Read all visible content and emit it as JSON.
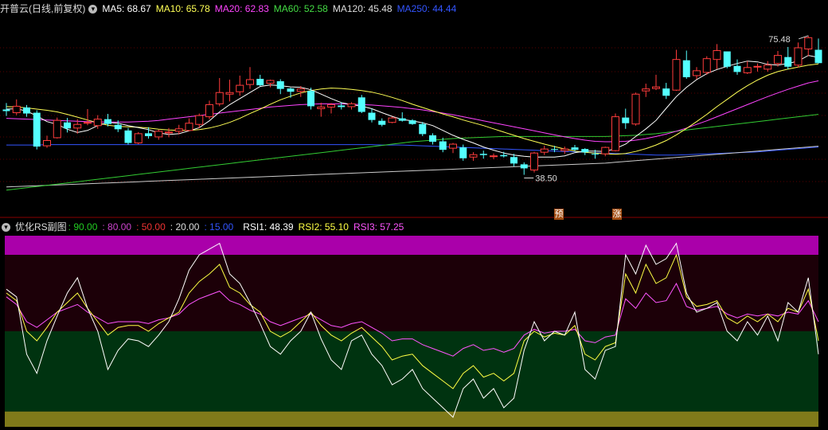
{
  "main_header": {
    "title": "开普云(日线,前复权)",
    "ma": [
      {
        "label": "MA5: 68.67",
        "color": "#ffffff"
      },
      {
        "label": "MA10: 65.78",
        "color": "#ffff55"
      },
      {
        "label": "MA20: 62.83",
        "color": "#ff44ff"
      },
      {
        "label": "MA60: 52.58",
        "color": "#44dd44"
      },
      {
        "label": "MA120: 45.48",
        "color": "#dddddd"
      },
      {
        "label": "MA250: 44.44",
        "color": "#3355ff"
      }
    ]
  },
  "annotations": {
    "high_label": "75.48",
    "low_label": "38.50",
    "tag_yu": "预",
    "tag_zhang": "涨"
  },
  "sub_header": {
    "title": "优化RS副图",
    "levels": [
      {
        "label": ": 90.00",
        "color": "#22cc22"
      },
      {
        "label": ": 80.00",
        "color": "#cc44cc"
      },
      {
        "label": ": 50.00",
        "color": "#ee3333"
      },
      {
        "label": ": 20.00",
        "color": "#dddddd"
      },
      {
        "label": ": 15.00",
        "color": "#3355ff"
      }
    ],
    "rsi": [
      {
        "label": "RSI1: 48.39",
        "color": "#ffffff"
      },
      {
        "label": "RSI2: 55.10",
        "color": "#ffff44"
      },
      {
        "label": "RSI3: 57.25",
        "color": "#ff55ff"
      }
    ]
  },
  "colors": {
    "up": "#ff3c3c",
    "down": "#54ffff",
    "ma5": "#ffffff",
    "ma10": "#ffff55",
    "ma20": "#ff44ff",
    "ma60": "#33cc33",
    "ma120": "#cccccc",
    "ma250": "#3355ff",
    "rsi1": "#ffffff",
    "rsi2": "#ffff44",
    "rsi3": "#ff55ff",
    "band_top": "#aa00aa",
    "band_upper": "#1c0008",
    "band_lower": "#003310",
    "band_bottom": "#807a1a"
  },
  "chart_data": [
    {
      "type": "candlestick",
      "title": "开普云(日线,前复权)",
      "ylim": [
        34,
        80
      ],
      "candles": [
        [
          57.2,
          58.8,
          55.6,
          56.8
        ],
        [
          56.4,
          59.7,
          55.8,
          58.0
        ],
        [
          57.7,
          58.3,
          55.4,
          56.2
        ],
        [
          56.4,
          57.0,
          47.3,
          48.0
        ],
        [
          48.2,
          50.7,
          47.7,
          49.5
        ],
        [
          50.2,
          55.2,
          50.0,
          54.5
        ],
        [
          54.0,
          55.1,
          51.5,
          52.5
        ],
        [
          52.6,
          54.8,
          51.2,
          53.5
        ],
        [
          53.8,
          57.3,
          53.3,
          54.0
        ],
        [
          53.2,
          55.8,
          52.4,
          54.8
        ],
        [
          54.8,
          56.1,
          53.0,
          53.6
        ],
        [
          53.4,
          54.5,
          51.6,
          52.3
        ],
        [
          52.0,
          52.6,
          48.5,
          48.9
        ],
        [
          48.9,
          51.6,
          48.6,
          51.2
        ],
        [
          51.3,
          52.8,
          50.0,
          50.6
        ],
        [
          50.4,
          52.2,
          49.7,
          51.8
        ],
        [
          51.4,
          52.6,
          50.3,
          51.6
        ],
        [
          51.8,
          53.4,
          51.0,
          52.4
        ],
        [
          52.0,
          55.0,
          51.8,
          53.8
        ],
        [
          53.5,
          56.2,
          52.6,
          55.7
        ],
        [
          55.4,
          59.4,
          54.8,
          58.4
        ],
        [
          58.6,
          65.0,
          58.0,
          61.4
        ],
        [
          61.0,
          64.6,
          59.2,
          61.4
        ],
        [
          61.6,
          65.6,
          60.6,
          63.2
        ],
        [
          63.4,
          67.7,
          62.3,
          64.6
        ],
        [
          64.8,
          65.8,
          63.0,
          63.2
        ],
        [
          63.7,
          64.6,
          62.7,
          64.4
        ],
        [
          64.2,
          64.7,
          61.0,
          62.3
        ],
        [
          62.4,
          62.6,
          60.1,
          61.6
        ],
        [
          61.7,
          63.0,
          60.3,
          62.3
        ],
        [
          61.8,
          62.6,
          57.2,
          58.0
        ],
        [
          57.4,
          58.9,
          55.4,
          57.8
        ],
        [
          57.8,
          58.8,
          56.2,
          58.4
        ],
        [
          58.2,
          59.0,
          57.2,
          57.8
        ],
        [
          57.9,
          59.0,
          57.2,
          58.6
        ],
        [
          60.2,
          60.8,
          56.3,
          56.6
        ],
        [
          56.4,
          57.4,
          54.0,
          54.6
        ],
        [
          54.4,
          55.0,
          53.0,
          53.4
        ],
        [
          54.0,
          55.4,
          53.8,
          55.1
        ],
        [
          55.0,
          56.5,
          54.2,
          54.4
        ],
        [
          54.5,
          54.8,
          53.4,
          53.6
        ],
        [
          53.6,
          54.1,
          50.6,
          51.1
        ],
        [
          50.8,
          51.3,
          48.5,
          49.2
        ],
        [
          49.3,
          50.2,
          46.6,
          47.2
        ],
        [
          47.6,
          48.9,
          46.4,
          48.6
        ],
        [
          47.8,
          48.5,
          44.5,
          45.1
        ],
        [
          45.4,
          46.6,
          44.5,
          46.0
        ],
        [
          46.2,
          47.0,
          45.0,
          45.9
        ],
        [
          45.7,
          46.3,
          44.9,
          45.7
        ],
        [
          45.9,
          46.7,
          45.3,
          45.6
        ],
        [
          45.4,
          46.2,
          43.1,
          43.8
        ],
        [
          43.6,
          44.1,
          41.0,
          42.6
        ],
        [
          42.2,
          46.7,
          41.6,
          46.4
        ],
        [
          46.6,
          48.2,
          45.9,
          47.4
        ],
        [
          47.4,
          48.2,
          46.6,
          47.2
        ],
        [
          47.0,
          48.0,
          46.2,
          47.4
        ],
        [
          47.8,
          48.4,
          46.9,
          47.2
        ],
        [
          47.4,
          47.6,
          45.9,
          46.6
        ],
        [
          46.2,
          47.2,
          45.0,
          46.1
        ],
        [
          46.2,
          48.0,
          45.6,
          47.8
        ],
        [
          47.0,
          56.2,
          46.8,
          55.4
        ],
        [
          55.2,
          57.4,
          52.4,
          53.8
        ],
        [
          53.6,
          61.4,
          53.2,
          61.0
        ],
        [
          61.8,
          63.6,
          60.3,
          62.3
        ],
        [
          62.4,
          65.8,
          62.0,
          62.8
        ],
        [
          62.4,
          63.8,
          59.8,
          60.6
        ],
        [
          62.0,
          72.0,
          61.8,
          69.6
        ],
        [
          69.4,
          71.8,
          64.8,
          65.2
        ],
        [
          65.6,
          67.7,
          64.7,
          66.8
        ],
        [
          66.4,
          70.4,
          65.8,
          69.8
        ],
        [
          69.6,
          73.4,
          67.2,
          71.8
        ],
        [
          71.6,
          71.2,
          67.4,
          67.8
        ],
        [
          68.0,
          69.6,
          65.8,
          66.5
        ],
        [
          66.3,
          69.2,
          66.0,
          67.6
        ],
        [
          67.8,
          68.6,
          66.6,
          67.9
        ],
        [
          67.2,
          69.2,
          66.6,
          68.2
        ],
        [
          68.6,
          71.7,
          67.8,
          70.6
        ],
        [
          70.2,
          72.7,
          67.2,
          67.8
        ],
        [
          68.2,
          73.8,
          67.6,
          72.5
        ],
        [
          72.2,
          75.5,
          70.4,
          75.0
        ],
        [
          72.0,
          74.8,
          68.6,
          68.7
        ]
      ],
      "ma5": [
        57.3,
        57.4,
        56.8,
        55.6,
        54.2,
        53.5,
        52.3,
        51.5,
        52.0,
        53.2,
        54.0,
        53.8,
        53.2,
        52.7,
        52.2,
        51.4,
        51.0,
        51.2,
        51.9,
        52.7,
        54.4,
        56.6,
        58.4,
        59.9,
        61.4,
        62.9,
        63.3,
        63.1,
        62.8,
        62.7,
        62.1,
        61.0,
        59.9,
        58.9,
        58.4,
        58.0,
        57.4,
        56.4,
        55.5,
        54.7,
        54.4,
        53.9,
        53.2,
        52.0,
        50.8,
        49.8,
        48.9,
        47.9,
        47.1,
        46.4,
        45.9,
        45.6,
        45.4,
        45.4,
        45.4,
        45.7,
        46.5,
        46.9,
        46.9,
        46.8,
        47.5,
        48.6,
        50.5,
        52.4,
        54.5,
        57.5,
        60.4,
        62.7,
        64.6,
        66.1,
        67.1,
        67.9,
        68.6,
        69.2,
        69.0,
        68.4,
        68.2,
        68.6,
        69.2,
        70.6,
        70.1
      ],
      "ma10": [
        57.9,
        57.8,
        57.6,
        57.3,
        57.0,
        56.6,
        56.0,
        55.3,
        54.6,
        53.9,
        53.3,
        53.0,
        52.9,
        52.8,
        52.6,
        52.3,
        52.1,
        52.0,
        52.0,
        52.2,
        52.6,
        53.2,
        54.0,
        55.0,
        56.2,
        57.3,
        58.5,
        59.6,
        60.5,
        61.3,
        61.9,
        62.3,
        62.5,
        62.4,
        62.2,
        61.9,
        61.5,
        60.9,
        60.2,
        59.4,
        58.5,
        57.7,
        56.9,
        56.1,
        55.4,
        54.6,
        53.9,
        53.2,
        52.4,
        51.6,
        50.8,
        50.0,
        49.3,
        48.6,
        48.0,
        47.4,
        46.9,
        46.6,
        46.4,
        46.2,
        46.1,
        46.3,
        46.8,
        47.5,
        48.4,
        49.5,
        50.9,
        52.5,
        54.2,
        56.0,
        57.9,
        59.7,
        61.5,
        63.1,
        64.5,
        65.7,
        66.6,
        67.2,
        67.7,
        68.2,
        68.5
      ],
      "ma20": [
        55.0,
        54.9,
        54.8,
        54.7,
        54.6,
        54.5,
        54.4,
        54.3,
        54.2,
        54.1,
        54.1,
        54.1,
        54.1,
        54.2,
        54.3,
        54.5,
        54.8,
        55.1,
        55.4,
        55.7,
        56.0,
        56.3,
        56.6,
        56.9,
        57.2,
        57.5,
        57.8,
        58.0,
        58.2,
        58.4,
        58.5,
        58.6,
        58.6,
        58.6,
        58.5,
        58.4,
        58.3,
        58.1,
        57.9,
        57.7,
        57.4,
        57.1,
        56.7,
        56.3,
        55.9,
        55.4,
        54.9,
        54.4,
        53.9,
        53.4,
        52.9,
        52.4,
        51.9,
        51.4,
        50.9,
        50.4,
        50.0,
        49.6,
        49.3,
        49.2,
        49.2,
        49.3,
        49.6,
        50.0,
        50.5,
        51.1,
        51.8,
        52.6,
        53.5,
        54.4,
        55.4,
        56.4,
        57.4,
        58.4,
        59.4,
        60.4,
        61.3,
        62.2,
        63.0,
        63.8,
        64.3
      ],
      "ma60": [
        37.2,
        37.5,
        37.8,
        38.1,
        38.4,
        38.7,
        39.0,
        39.3,
        39.6,
        39.9,
        40.2,
        40.5,
        40.8,
        41.1,
        41.4,
        41.7,
        42.0,
        42.3,
        42.6,
        42.9,
        43.2,
        43.5,
        43.8,
        44.1,
        44.4,
        44.7,
        45.0,
        45.3,
        45.6,
        45.9,
        46.2,
        46.5,
        46.8,
        47.1,
        47.4,
        47.7,
        48.0,
        48.3,
        48.6,
        48.9,
        49.2,
        49.4,
        49.6,
        49.8,
        50.0,
        50.1,
        50.2,
        50.3,
        50.4,
        50.5,
        50.5,
        50.5,
        50.5,
        50.5,
        50.5,
        50.5,
        50.5,
        50.5,
        50.5,
        50.5,
        50.6,
        50.7,
        50.8,
        51.0,
        51.2,
        51.5,
        51.8,
        52.1,
        52.4,
        52.7,
        53.0,
        53.3,
        53.6,
        53.9,
        54.2,
        54.5,
        54.8,
        55.1,
        55.4,
        55.7,
        56.0
      ],
      "ma120": [
        38.0,
        38.1,
        38.2,
        38.3,
        38.4,
        38.5,
        38.6,
        38.7,
        38.8,
        38.9,
        39.0,
        39.1,
        39.2,
        39.3,
        39.4,
        39.5,
        39.6,
        39.7,
        39.8,
        39.9,
        40.0,
        40.1,
        40.2,
        40.3,
        40.4,
        40.5,
        40.6,
        40.7,
        40.8,
        40.9,
        41.0,
        41.1,
        41.2,
        41.3,
        41.4,
        41.5,
        41.6,
        41.7,
        41.8,
        41.9,
        42.0,
        42.1,
        42.2,
        42.3,
        42.4,
        42.5,
        42.6,
        42.7,
        42.8,
        42.9,
        43.0,
        43.1,
        43.2,
        43.3,
        43.4,
        43.5,
        43.6,
        43.7,
        43.8,
        43.9,
        44.1,
        44.3,
        44.5,
        44.7,
        44.9,
        45.1,
        45.3,
        45.5,
        45.7,
        45.9,
        46.1,
        46.3,
        46.5,
        46.7,
        46.9,
        47.1,
        47.3,
        47.5,
        47.7,
        47.9,
        48.1
      ],
      "ma250": [
        48.4,
        48.4,
        48.4,
        48.4,
        48.5,
        48.5,
        48.5,
        48.5,
        48.5,
        48.5,
        48.5,
        48.5,
        48.5,
        48.5,
        48.5,
        48.5,
        48.5,
        48.5,
        48.5,
        48.5,
        48.5,
        48.5,
        48.5,
        48.5,
        48.5,
        48.5,
        48.5,
        48.5,
        48.5,
        48.5,
        48.5,
        48.5,
        48.5,
        48.5,
        48.5,
        48.5,
        48.5,
        48.4,
        48.4,
        48.4,
        48.3,
        48.2,
        48.1,
        48.0,
        47.9,
        47.8,
        47.7,
        47.6,
        47.5,
        47.4,
        47.3,
        47.2,
        47.1,
        47.0,
        46.9,
        46.8,
        46.7,
        46.6,
        46.5,
        46.4,
        46.3,
        46.2,
        46.1,
        46.0,
        45.9,
        45.9,
        45.9,
        46.0,
        46.1,
        46.2,
        46.3,
        46.4,
        46.5,
        46.6,
        46.7,
        46.9,
        47.1,
        47.3,
        47.5,
        47.7,
        47.9
      ]
    },
    {
      "type": "line",
      "title": "优化RS副图",
      "ylim": [
        0,
        100
      ],
      "levels": [
        90,
        80,
        50,
        20,
        15
      ],
      "series": [
        {
          "name": "RSI1",
          "values": [
            72,
            68,
            38,
            28,
            45,
            58,
            70,
            78,
            62,
            50,
            30,
            40,
            46,
            45,
            42,
            48,
            55,
            67,
            82,
            90,
            93,
            96,
            80,
            75,
            65,
            54,
            42,
            38,
            45,
            50,
            60,
            46,
            35,
            30,
            45,
            48,
            38,
            32,
            22,
            25,
            30,
            20,
            15,
            10,
            5,
            20,
            25,
            15,
            20,
            10,
            15,
            40,
            55,
            45,
            50,
            48,
            60,
            30,
            25,
            40,
            42,
            90,
            80,
            95,
            85,
            88,
            96,
            70,
            60,
            62,
            65,
            50,
            45,
            55,
            48,
            58,
            45,
            65,
            60,
            78,
            38
          ]
        },
        {
          "name": "RSI2",
          "values": [
            70,
            66,
            50,
            45,
            52,
            60,
            65,
            70,
            62,
            55,
            48,
            52,
            53,
            53,
            50,
            54,
            57,
            60,
            70,
            76,
            80,
            85,
            73,
            70,
            64,
            60,
            50,
            47,
            50,
            55,
            60,
            53,
            48,
            45,
            49,
            52,
            47,
            42,
            35,
            37,
            38,
            32,
            28,
            24,
            20,
            28,
            32,
            26,
            28,
            24,
            28,
            45,
            50,
            47,
            49,
            48,
            53,
            38,
            35,
            42,
            44,
            80,
            70,
            85,
            75,
            78,
            90,
            68,
            63,
            64,
            66,
            57,
            54,
            58,
            55,
            59,
            55,
            62,
            60,
            72,
            45
          ]
        },
        {
          "name": "RSI3",
          "values": [
            68,
            64,
            55,
            52,
            56,
            60,
            62,
            64,
            60,
            57,
            54,
            55,
            55,
            55,
            54,
            56,
            57,
            59,
            64,
            67,
            69,
            71,
            66,
            64,
            61,
            59,
            55,
            53,
            55,
            57,
            59,
            56,
            53,
            52,
            54,
            55,
            52,
            49,
            45,
            46,
            46,
            43,
            41,
            39,
            37,
            41,
            43,
            40,
            41,
            39,
            41,
            48,
            51,
            49,
            50,
            50,
            51,
            45,
            44,
            47,
            48,
            67,
            62,
            70,
            65,
            66,
            75,
            63,
            61,
            62,
            63,
            59,
            57,
            59,
            58,
            59,
            58,
            60,
            59,
            66,
            55
          ]
        }
      ]
    }
  ]
}
